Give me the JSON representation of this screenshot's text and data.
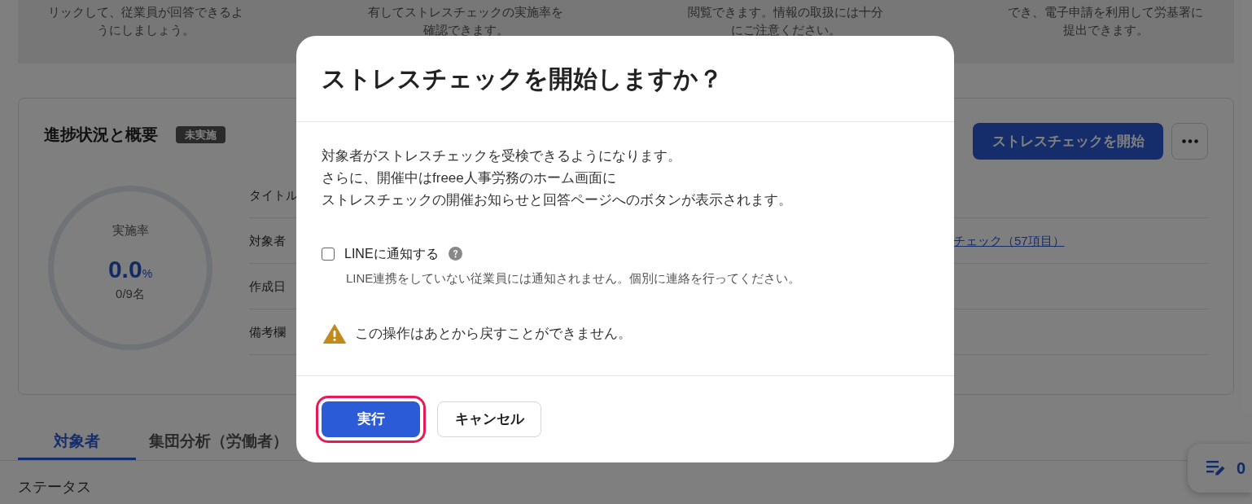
{
  "page": {
    "intro_columns": [
      {
        "lines": [
          "リックして、従業員が回答できるよ",
          "うにしましょう。"
        ]
      },
      {
        "lines": [
          "有してストレスチェックの実施率を",
          "確認できます。"
        ]
      },
      {
        "lines": [
          "閲覧できます。情報の取扱には十分",
          "にご注意ください。"
        ]
      },
      {
        "lines": [
          "でき、電子申請を利用して労基署に",
          "提出できます。"
        ]
      }
    ],
    "summary_card": {
      "title": "進捗状況と概要",
      "badge": "未実施",
      "start_button": "ストレスチェックを開始",
      "progress": {
        "label": "実施率",
        "value": "0.0",
        "unit": "%",
        "count": "0/9名",
        "level": 0
      },
      "details": [
        {
          "label": "タイトル"
        },
        {
          "label": "対象者",
          "value": "チェック（57項目）"
        },
        {
          "label": "作成日"
        },
        {
          "label": "備考欄"
        }
      ]
    },
    "tabs": [
      {
        "label": "対象者",
        "selected": true
      },
      {
        "label": "集団分析（労働者）",
        "selected": false
      }
    ],
    "filter_label": "ステータス",
    "memo_widget": {
      "count": "0"
    }
  },
  "dialog": {
    "title": "ストレスチェックを開始しますか？",
    "description_lines": [
      "対象者がストレスチェックを受検できるようになります。",
      "さらに、開催中はfreee人事労務のホーム画面に",
      "ストレスチェックの開催お知らせと回答ページへのボタンが表示されます。"
    ],
    "line_notify": {
      "label": "LINEに通知する",
      "checked": false,
      "hint": "LINE連携をしていない従業員には通知されません。個別に連絡を行ってください。"
    },
    "warning": "この操作はあとから戻すことができません。",
    "buttons": [
      {
        "label": "実行",
        "kind": "primary",
        "focused": true
      },
      {
        "label": "キャンセル",
        "kind": "secondary",
        "focused": false
      }
    ]
  }
}
